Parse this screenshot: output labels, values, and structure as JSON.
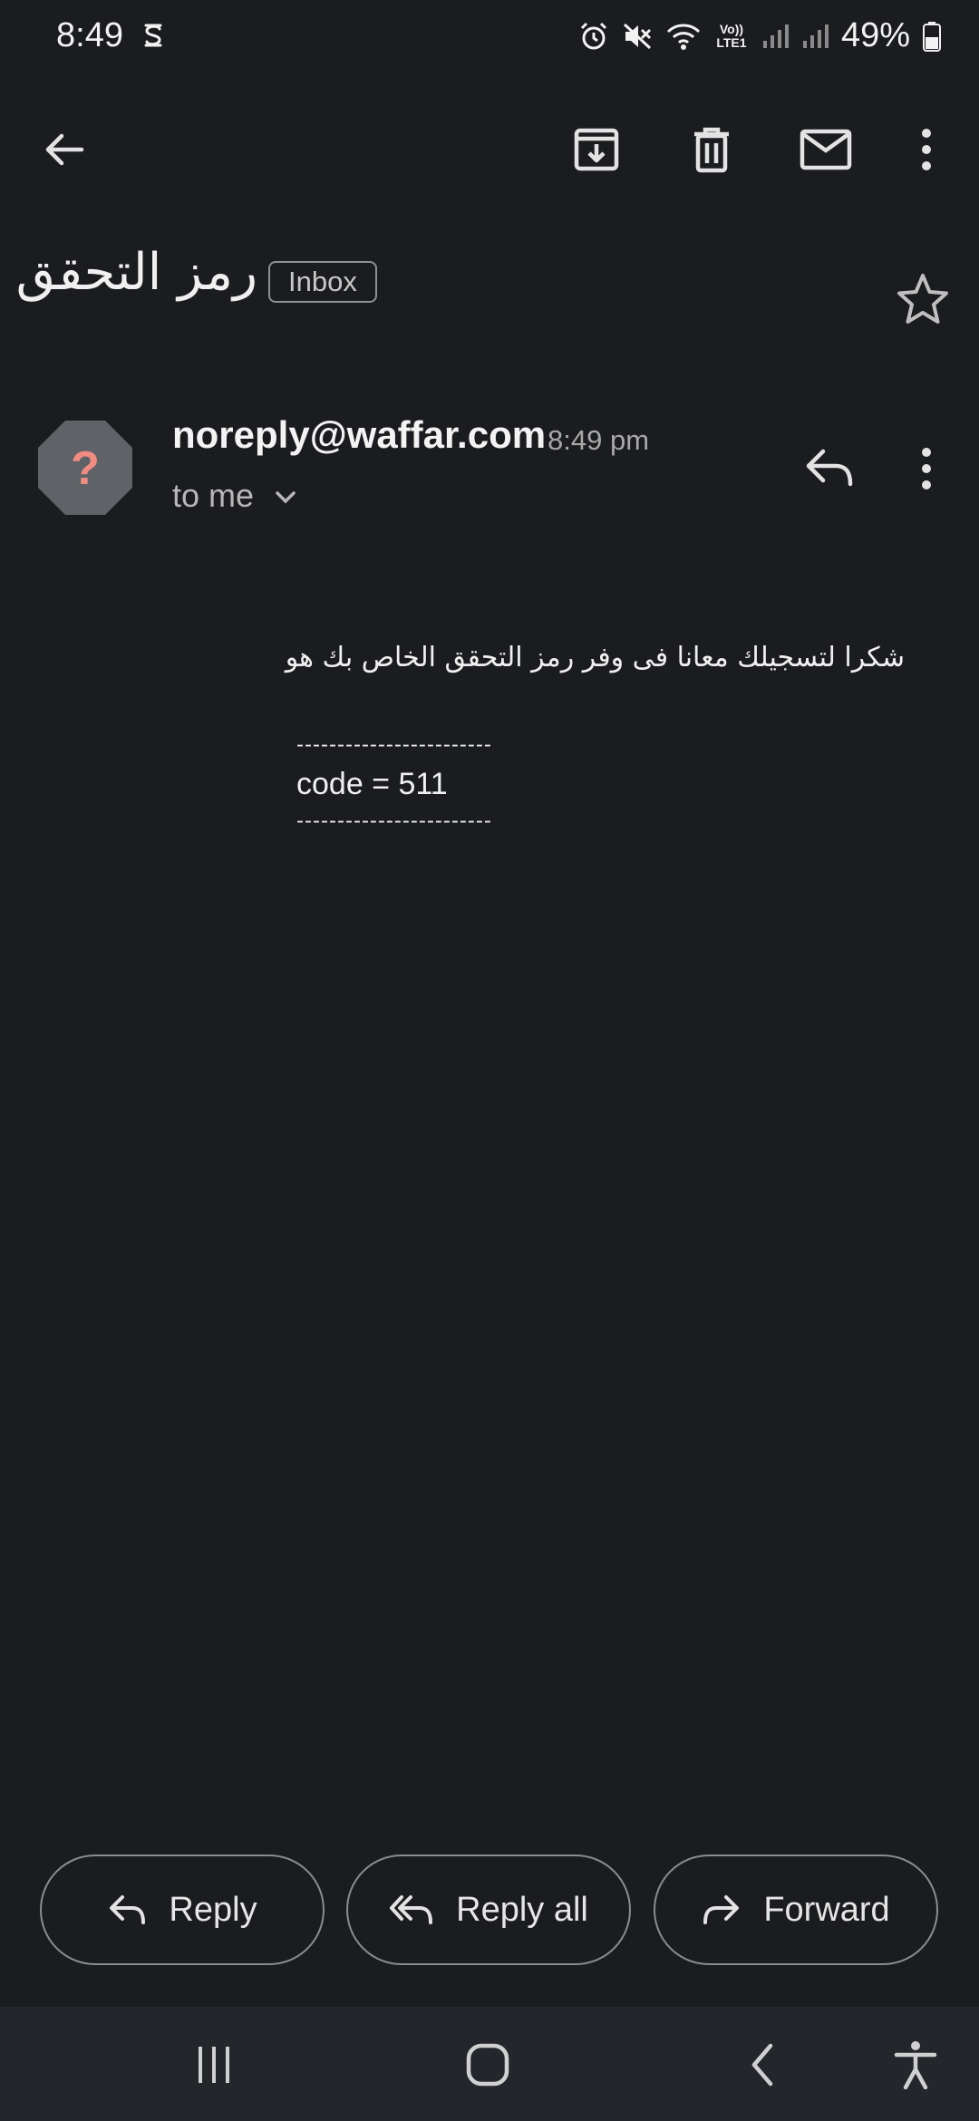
{
  "status_bar": {
    "time": "8:49",
    "network_label": "Vo)) LTE1",
    "battery": "49%"
  },
  "toolbar": {
    "icons": [
      "back-arrow-icon",
      "archive-icon",
      "delete-icon",
      "mail-icon",
      "more-vert-icon"
    ]
  },
  "email": {
    "subject": "رمز التحقق",
    "label_chip": "Inbox",
    "sender": "noreply@waffar.com",
    "time": "8:49 pm",
    "recipient": "to me",
    "avatar_glyph": "?",
    "body_line": "شكرا لتسجيلك معانا فى وفر  رمز التحقق الخاص بك هو",
    "separator": "------------------------",
    "code_line": "code = 511"
  },
  "actions": {
    "reply": "Reply",
    "reply_all": "Reply all",
    "forward": "Forward"
  },
  "nav": {
    "icons": [
      "recents-icon",
      "home-icon",
      "back-icon",
      "accessibility-icon"
    ]
  },
  "colors": {
    "background": "#1b1c1f",
    "avatar_bg": "#5f6368",
    "avatar_glyph": "#f28b82",
    "navbar": "#23262b"
  }
}
